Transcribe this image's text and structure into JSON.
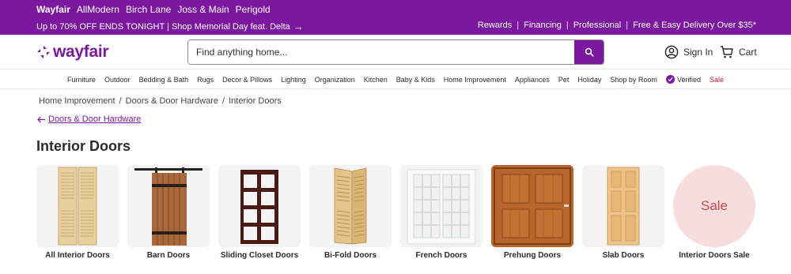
{
  "topbar": {
    "brands": [
      "Wayfair",
      "AllModern",
      "Birch Lane",
      "Joss & Main",
      "Perigold"
    ],
    "promo": "Up to 70% OFF ENDS TONIGHT | Shop Memorial Day feat. Delta",
    "links": [
      "Rewards",
      "Financing",
      "Professional",
      "Free & Easy Delivery Over $35*"
    ],
    "color": "#7b189f"
  },
  "header": {
    "logo_text": "wayfair",
    "search_placeholder": "Find anything home...",
    "signin_label": "Sign In",
    "cart_label": "Cart"
  },
  "nav": {
    "items": [
      "Furniture",
      "Outdoor",
      "Bedding & Bath",
      "Rugs",
      "Decor & Pillows",
      "Lighting",
      "Organization",
      "Kitchen",
      "Baby & Kids",
      "Home Improvement",
      "Appliances",
      "Pet",
      "Holiday",
      "Shop by Room",
      "Verified",
      "Sale"
    ],
    "sale_color": "#c0132c"
  },
  "breadcrumb": [
    "Home Improvement",
    "/",
    "Doors & Door Hardware",
    "/",
    "Interior Doors"
  ],
  "back_link": "Doors & Door Hardware",
  "page_title": "Interior Doors",
  "tiles": [
    {
      "name": "All Interior Doors"
    },
    {
      "name": "Barn Doors"
    },
    {
      "name": "Sliding Closet Doors"
    },
    {
      "name": "Bi-Fold Doors"
    },
    {
      "name": "French Doors"
    },
    {
      "name": "Prehung Doors"
    },
    {
      "name": "Slab Doors"
    },
    {
      "name": "Interior Doors Sale",
      "badge": "Sale"
    }
  ]
}
